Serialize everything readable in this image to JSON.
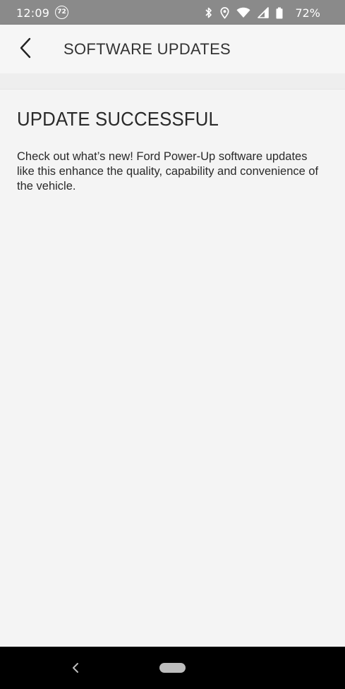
{
  "status_bar": {
    "time": "12:09",
    "temp_badge": "72",
    "battery_percent": "72%",
    "icons": [
      "bluetooth-icon",
      "location-icon",
      "wifi-icon",
      "cell-signal-icon",
      "battery-icon"
    ]
  },
  "header": {
    "title": "SOFTWARE UPDATES",
    "back_icon": "chevron-left-icon"
  },
  "content": {
    "heading": "UPDATE SUCCESSFUL",
    "body": "Check out what’s new! Ford Power-Up software updates like this enhance the quality, capability and convenience of the vehicle."
  },
  "nav_bar": {
    "back_icon": "nav-back-icon",
    "home_icon": "home-pill-icon"
  },
  "colors": {
    "status_bar_bg": "#8a8a8a",
    "page_bg": "#f4f4f4",
    "text": "#2a2a2a",
    "nav_bar_bg": "#000000"
  }
}
